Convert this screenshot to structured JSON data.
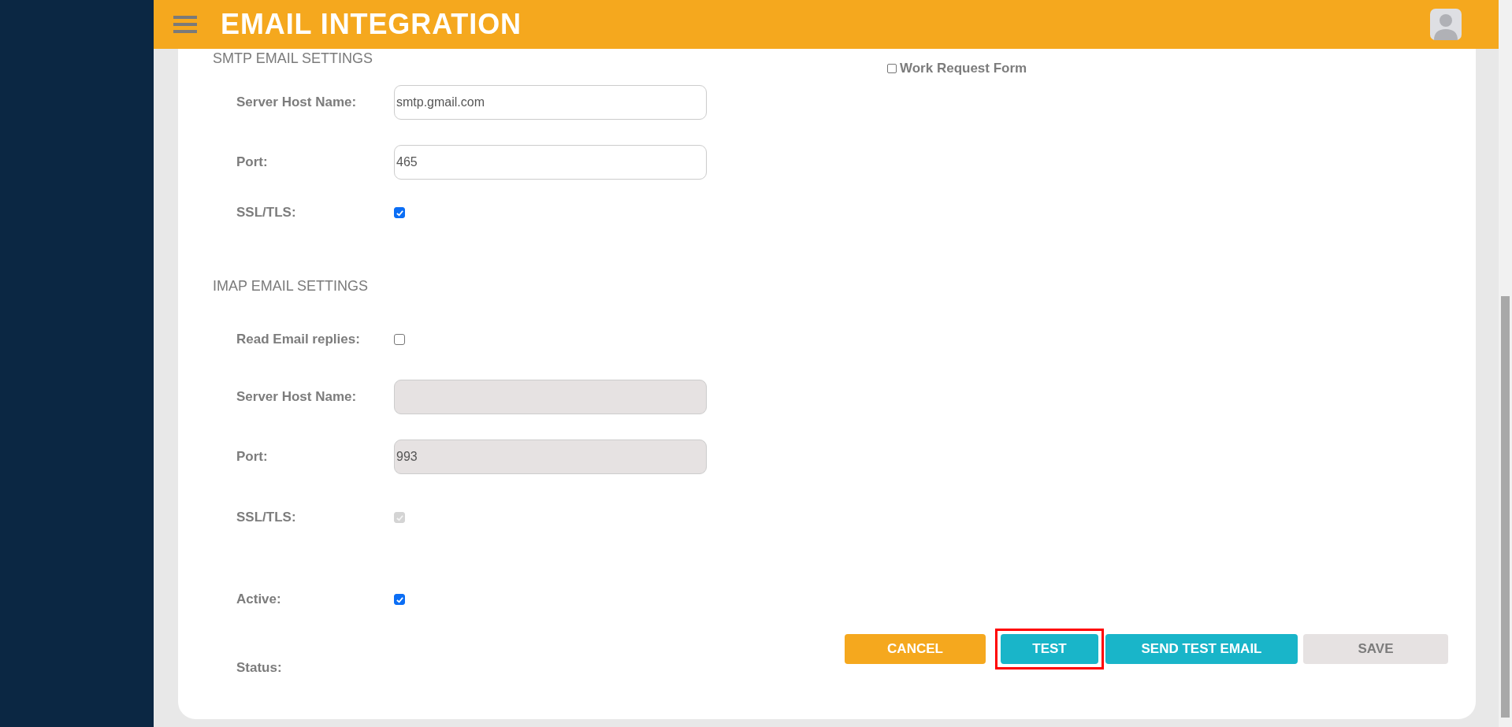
{
  "header": {
    "title": "EMAIL INTEGRATION"
  },
  "smtp": {
    "heading": "SMTP EMAIL SETTINGS",
    "fields": [
      {
        "kind": "text",
        "label": "Server Host Name:",
        "value": "smtp.gmail.com",
        "disabled": false
      },
      {
        "kind": "text",
        "label": "Port:",
        "value": "465",
        "disabled": false
      },
      {
        "kind": "checkbox",
        "label": "SSL/TLS:",
        "checked": true,
        "disabled": false
      }
    ]
  },
  "forms": [
    {
      "label": "Work Request Form",
      "checked": false
    }
  ],
  "imap": {
    "heading": "IMAP EMAIL SETTINGS",
    "fields": [
      {
        "kind": "checkbox",
        "label": "Read Email replies:",
        "checked": false,
        "disabled": false
      },
      {
        "kind": "text",
        "label": "Server Host Name:",
        "disabled": true
      },
      {
        "kind": "text",
        "label": "Port:",
        "value": "993",
        "disabled": true
      },
      {
        "kind": "checkbox",
        "label": "SSL/TLS:",
        "checked": true,
        "disabled": true
      }
    ]
  },
  "active": {
    "label": "Active:",
    "checked": true
  },
  "status": {
    "label": "Status:"
  },
  "buttons": [
    {
      "label": "CANCEL",
      "kind": "warning",
      "highlighted": false
    },
    {
      "label": "TEST",
      "kind": "primary",
      "highlighted": true
    },
    {
      "label": "SEND TEST EMAIL",
      "kind": "primary",
      "highlighted": false
    },
    {
      "label": "SAVE",
      "kind": "disabled",
      "highlighted": false
    }
  ]
}
